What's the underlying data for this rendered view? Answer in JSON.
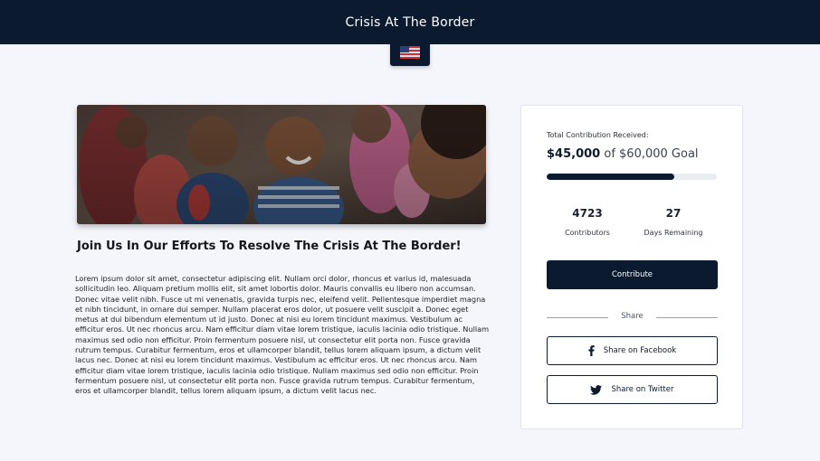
{
  "header": {
    "title": "Crisis At The Border"
  },
  "hero": {
    "alt_icon": "flag-usa-icon"
  },
  "article": {
    "headline": "Join Us In Our Efforts To Resolve The Crisis At The Border!",
    "body": "Lorem ipsum dolor sit amet, consectetur adipiscing elit. Nullam orci dolor, rhoncus et varius id, malesuada sollicitudin leo. Aliquam pretium mollis elit, sit amet lobortis dolor. Mauris convallis eu libero non accumsan. Donec vitae velit nibh. Fusce ut mi venenatis, gravida turpis nec, eleifend velit. Pellentesque imperdiet magna et nibh tincidunt, in ornare dui semper. Nullam placerat eros dolor, ut posuere velit suscipit a. Donec eget metus at dui bibendum elementum ut id justo. Donec at nisi eu lorem tincidunt maximus. Vestibulum ac efficitur eros. Ut nec rhoncus arcu. Nam efficitur diam vitae lorem tristique, iaculis lacinia odio tristique. Nullam maximus sed odio non efficitur. Proin fermentum posuere nisl, ut consectetur elit porta non. Fusce gravida rutrum tempus. Curabitur fermentum, eros et ullamcorper blandit, tellus lorem aliquam ipsum, a dictum velit lacus nec. Donec at nisi eu lorem tincidunt maximus. Vestibulum ac efficitur eros. Ut nec rhoncus arcu. Nam efficitur diam vitae lorem tristique, iaculis lacinia odio tristique. Nullam maximus sed odio non efficitur. Proin fermentum posuere nisl, ut consectetur elit porta non. Fusce gravida rutrum tempus. Curabitur fermentum, eros et ullamcorper blandit, tellus lorem aliquam ipsum, a dictum velit lacus nec."
  },
  "campaign": {
    "total_label": "Total Contribution Received:",
    "raised": "$45,000",
    "goal_text": "of $60,000 Goal",
    "progress_fraction": 0.75,
    "contributors_count": "4723",
    "contributors_label": "Contributors",
    "days_count": "27",
    "days_label": "Days Remaining",
    "contribute_label": "Contribute",
    "share_label": "Share",
    "facebook_label": "Share on Facebook",
    "twitter_label": "Share on Twitter"
  },
  "icons": {
    "flag": "flag-usa-icon",
    "facebook": "facebook-icon",
    "twitter": "twitter-icon"
  },
  "colors": {
    "brand_navy": "#0c1a2f",
    "page_bg": "#f4f6fc",
    "progress_track": "#e9ecf1"
  }
}
